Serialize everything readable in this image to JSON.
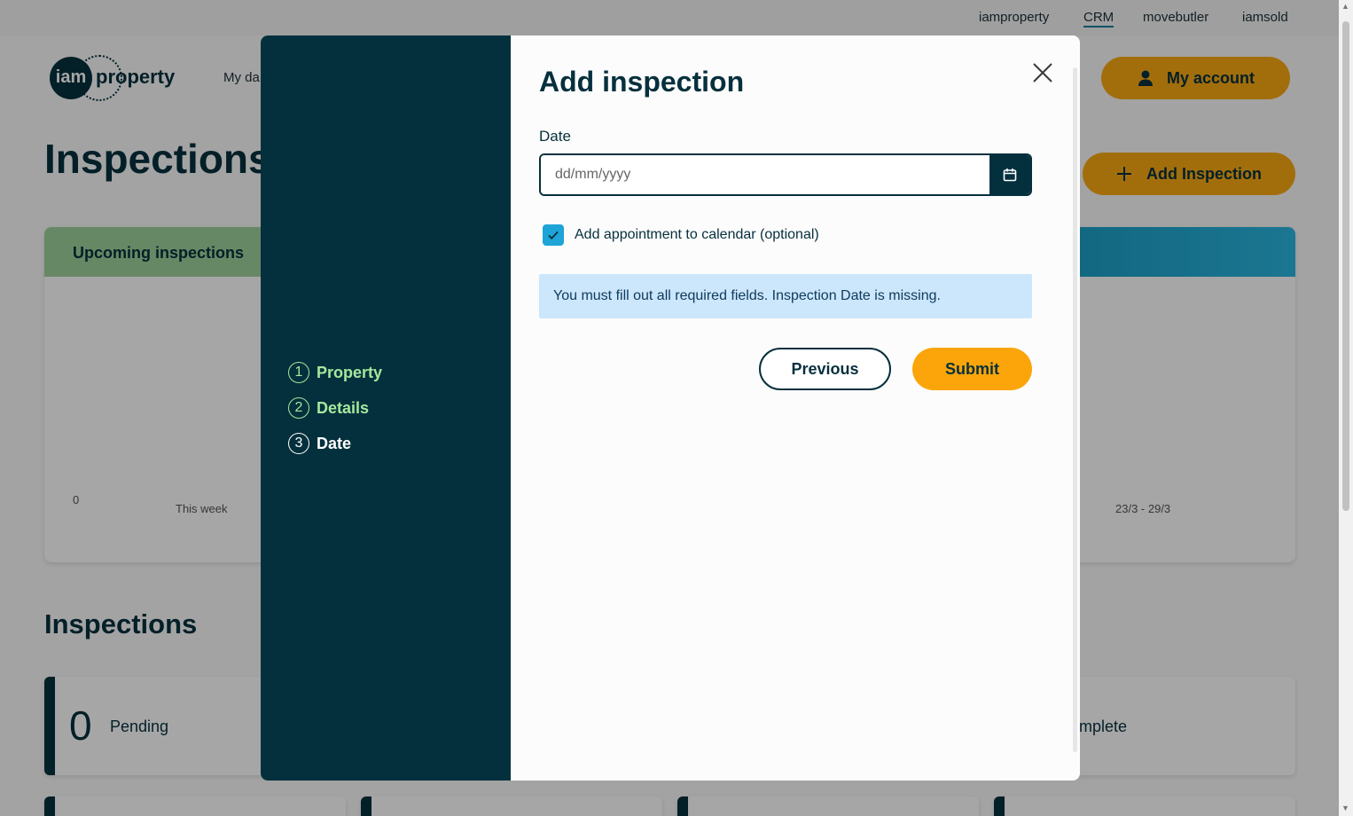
{
  "topbar": {
    "links": [
      "iamproperty",
      "CRM",
      "movebutler",
      "iamsold"
    ]
  },
  "logo": {
    "mark": "iam",
    "word": "property"
  },
  "nav": {
    "item": "My da"
  },
  "header": {
    "account_label": "My account",
    "add_label": "Add Inspection",
    "page_title": "Inspections"
  },
  "upcoming": {
    "title": "Upcoming inspections",
    "axis_zero": "0",
    "this_week": "This week",
    "range": "23/3 - 29/3"
  },
  "inspections": {
    "title": "Inspections",
    "pending_count": "0",
    "pending_label": "Pending",
    "complete_label": "mplete"
  },
  "modal": {
    "title": "Add inspection",
    "steps": [
      {
        "num": "1",
        "label": "Property",
        "state": "done"
      },
      {
        "num": "2",
        "label": "Details",
        "state": "done"
      },
      {
        "num": "3",
        "label": "Date",
        "state": "current"
      }
    ],
    "date_label": "Date",
    "date_placeholder": "dd/mm/yyyy",
    "calendar_label": "Add appointment to calendar (optional)",
    "calendar_checked": true,
    "alert": "You must fill out all required fields. Inspection Date is missing.",
    "previous_label": "Previous",
    "submit_label": "Submit"
  },
  "colors": {
    "brand_dark": "#04303d",
    "accent_orange": "#f9a913",
    "step_done": "#a6e89c",
    "checkbox_blue": "#1ea4d6",
    "alert_bg": "#cce6fb"
  }
}
